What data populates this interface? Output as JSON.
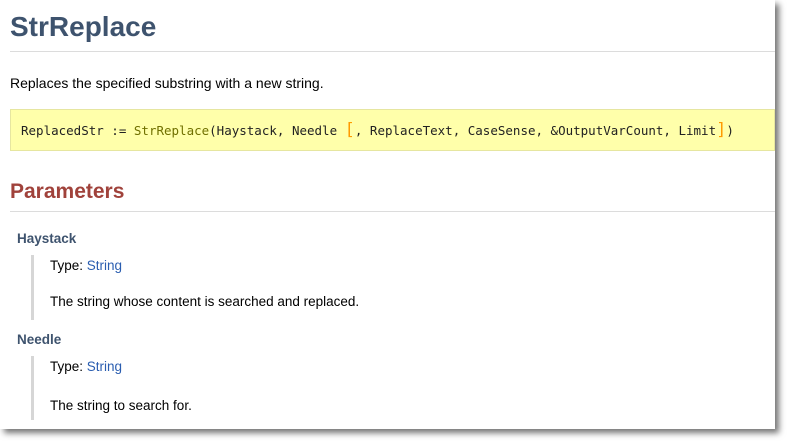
{
  "title": "StrReplace",
  "description": "Replaces the specified substring with a new string.",
  "syntax": {
    "prefix": "ReplacedStr := ",
    "function": "StrReplace",
    "open": "(Haystack, Needle ",
    "bracket_open": "[",
    "optional": ", ReplaceText, CaseSense, &OutputVarCount, Limit",
    "bracket_close": "]",
    "close": ")"
  },
  "parameters_heading": "Parameters",
  "parameters": [
    {
      "name": "Haystack",
      "type_label": "Type: ",
      "type_link": "String",
      "description": "The string whose content is searched and replaced."
    },
    {
      "name": "Needle",
      "type_label": "Type: ",
      "type_link": "String",
      "description": "The string to search for."
    }
  ],
  "colors": {
    "title": "#3e536e",
    "heading": "#a0423b",
    "syntax_bg": "#ffffaa",
    "link": "#2a5db0",
    "bracket": "#ff9a00"
  }
}
